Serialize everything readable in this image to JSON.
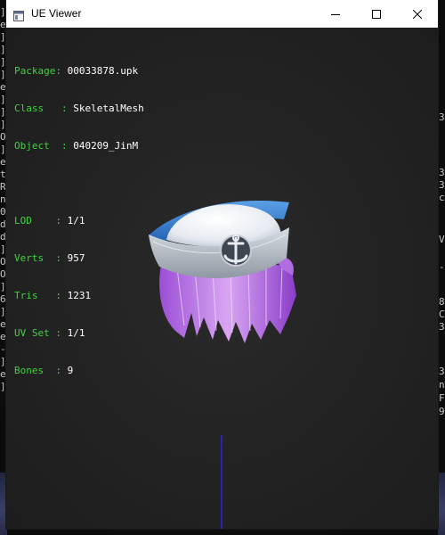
{
  "window": {
    "title": "UE Viewer"
  },
  "info": {
    "package_label": "Package",
    "package_value": "00033878.upk",
    "class_label": "Class",
    "class_value": "SkeletalMesh",
    "object_label": "Object",
    "object_value": "040209_JinM",
    "lod_label": "LOD",
    "lod_value": "1/1",
    "verts_label": "Verts",
    "verts_value": "957",
    "tris_label": "Tris",
    "tris_value": "1231",
    "uvset_label": "UV Set",
    "uvset_value": "1/1",
    "bones_label": "Bones",
    "bones_value": "9"
  },
  "background_console": {
    "left_chars": [
      "]",
      "e",
      "]",
      "]",
      "]",
      "]",
      "e",
      "]",
      "]",
      "]",
      "O",
      "]",
      "e",
      "t",
      "R",
      "n",
      "0",
      "d",
      "d",
      "]",
      "O",
      "O",
      "]",
      "6",
      "]",
      "e",
      "e",
      "-",
      "]",
      "e",
      "]"
    ],
    "right_chars": [
      "3",
      "3",
      "3",
      "c",
      "V",
      "8",
      "C",
      "3",
      "3",
      "n",
      "F",
      "9",
      "-"
    ]
  },
  "colors": {
    "label_green": "#3fd33f",
    "value_white": "#ffffff",
    "viewport_bg": "#232323",
    "axis_blue": "#2424b8"
  },
  "icons": {
    "app": "window-app-icon",
    "minimize": "minimize-icon",
    "maximize": "maximize-icon",
    "close": "close-icon"
  }
}
